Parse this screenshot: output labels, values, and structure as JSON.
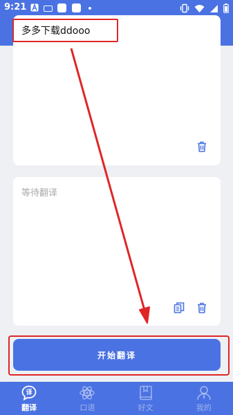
{
  "status_bar": {
    "time": "9:21",
    "notification_icons": [
      "a-icon",
      "keyboard-icon",
      "app-icon",
      "app-icon",
      "dot-icon"
    ],
    "system_icons": [
      "vibrate-icon",
      "wifi-icon",
      "signal-icon",
      "battery-icon"
    ]
  },
  "input_card": {
    "source_text": "多多下载ddooo",
    "delete_icon": "trash-icon"
  },
  "output_card": {
    "placeholder": "等待翻译",
    "copy_icon": "copy-icon",
    "delete_icon": "trash-icon"
  },
  "start_button": {
    "label": "开始翻译"
  },
  "bottom_nav": {
    "items": [
      {
        "label": "翻译",
        "icon": "translate-bubble-icon",
        "active": true
      },
      {
        "label": "口语",
        "icon": "atom-icon",
        "active": false
      },
      {
        "label": "好文",
        "icon": "book-icon",
        "active": false
      },
      {
        "label": "我的",
        "icon": "user-icon",
        "active": false
      }
    ]
  },
  "colors": {
    "primary": "#4a72e2",
    "background": "#eef0f4",
    "annotation": "#e02525",
    "placeholder": "#aaaaaa"
  }
}
